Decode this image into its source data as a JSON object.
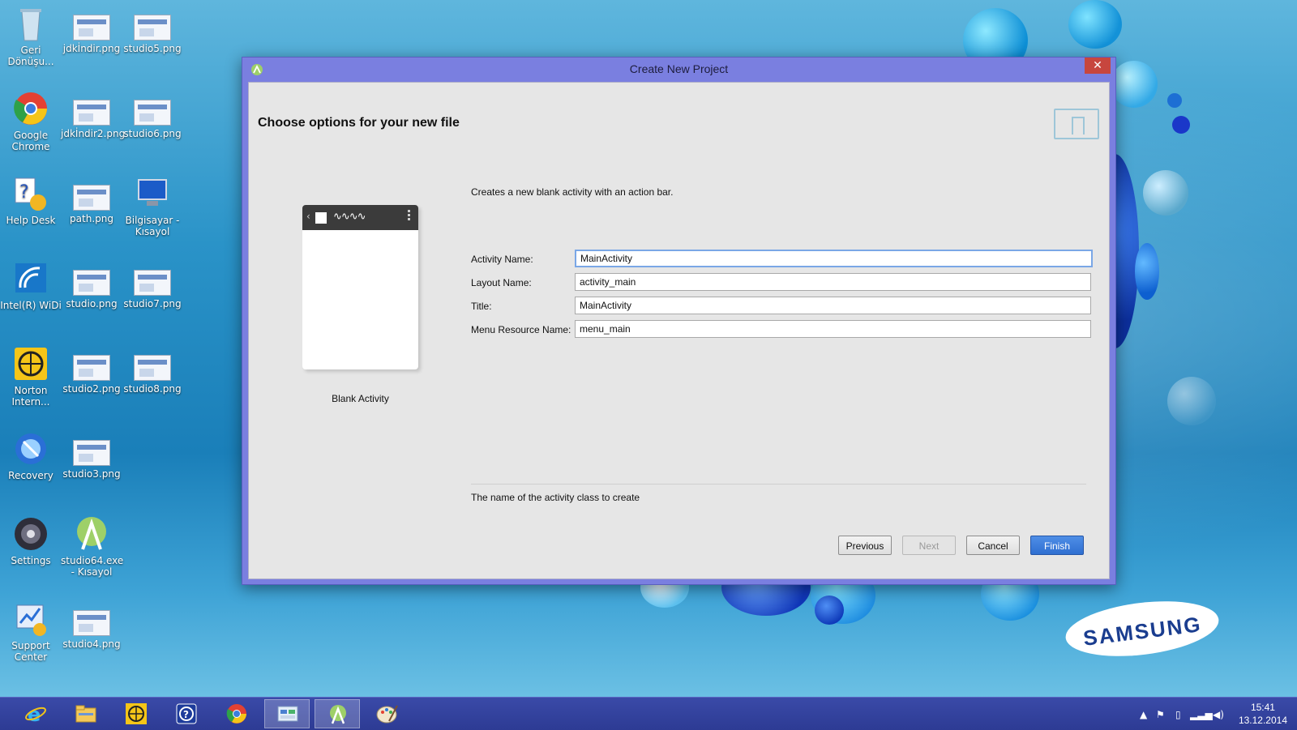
{
  "desktop": {
    "icons": [
      {
        "label": "Geri Dönüşu...",
        "icon": "recycle-bin-icon"
      },
      {
        "label": "jdkİndir.png",
        "icon": "png-file-icon"
      },
      {
        "label": "studio5.png",
        "icon": "png-file-icon"
      },
      {
        "label": "Google Chrome",
        "icon": "chrome-icon"
      },
      {
        "label": "jdkİndir2.png",
        "icon": "png-file-icon"
      },
      {
        "label": "studio6.png",
        "icon": "png-file-icon"
      },
      {
        "label": "Help Desk",
        "icon": "help-desk-icon"
      },
      {
        "label": "path.png",
        "icon": "png-file-icon"
      },
      {
        "label": "Bilgisayar - Kısayol",
        "icon": "computer-icon"
      },
      {
        "label": "Intel(R) WiDi",
        "icon": "intel-widi-icon"
      },
      {
        "label": "studio.png",
        "icon": "png-file-icon"
      },
      {
        "label": "studio7.png",
        "icon": "png-file-icon"
      },
      {
        "label": "Norton Intern...",
        "icon": "norton-icon"
      },
      {
        "label": "studio2.png",
        "icon": "png-file-icon"
      },
      {
        "label": "studio8.png",
        "icon": "png-file-icon"
      },
      {
        "label": "Recovery",
        "icon": "recovery-icon"
      },
      {
        "label": "studio3.png",
        "icon": "png-file-icon"
      },
      {
        "label": "Settings",
        "icon": "settings-icon"
      },
      {
        "label": "studio64.exe - Kısayol",
        "icon": "android-studio-icon"
      },
      {
        "label": "Support Center",
        "icon": "support-center-icon"
      },
      {
        "label": "studio4.png",
        "icon": "png-file-icon"
      }
    ],
    "brand": "SAMSUNG"
  },
  "dialog": {
    "title": "Create New Project",
    "close_icon": "close-icon",
    "heading": "Choose options for your new file",
    "description": "Creates a new blank activity with an action bar.",
    "template_name": "Blank Activity",
    "fields": [
      {
        "label": "Activity Name:",
        "value": "MainActivity",
        "focused": true
      },
      {
        "label": "Layout Name:",
        "value": "activity_main",
        "focused": false
      },
      {
        "label": "Title:",
        "value": "MainActivity",
        "focused": false
      },
      {
        "label": "Menu Resource Name:",
        "value": "menu_main",
        "focused": false
      }
    ],
    "hint": "The name of the activity class to create",
    "buttons": {
      "previous": "Previous",
      "next": "Next",
      "cancel": "Cancel",
      "finish": "Finish"
    }
  },
  "taskbar": {
    "apps": [
      "internet-explorer-icon",
      "file-explorer-icon",
      "norton-icon",
      "help-icon",
      "chrome-icon",
      "control-panel-icon",
      "android-studio-icon",
      "paint-icon"
    ],
    "active_app": "android-studio-icon",
    "clock_time": "15:41",
    "clock_date": "13.12.2014"
  },
  "colors": {
    "dialog_frame": "#7a7fe0",
    "close_button": "#c7463e",
    "primary_button": "#2f6fd1",
    "taskbar": "#2d3b94"
  }
}
